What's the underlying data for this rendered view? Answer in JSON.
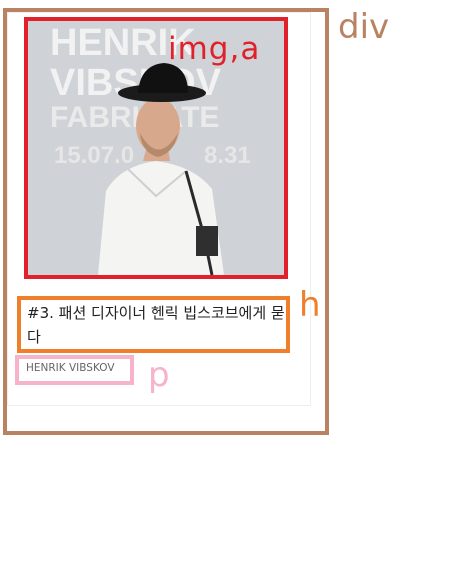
{
  "annotations": {
    "div_label": "div",
    "img_label": "img,a",
    "h_label": "h",
    "p_label": "p"
  },
  "card": {
    "image": {
      "alt": "Henrik Vibskov portrait",
      "poster_text": {
        "line1": "HENRIK",
        "line2": "VIBSKOV",
        "line3": "FABRIKATE",
        "date": "15.07.0",
        "date_end": "8.31"
      }
    },
    "title": "#3. 패션 디자이너 헨릭 빕스코브에게 묻다",
    "subtitle": "HENRIK VIBSKOV"
  },
  "colors": {
    "div_annotation": "#b98363",
    "img_annotation": "#e0202a",
    "h_annotation": "#f07f2c",
    "p_annotation": "#f6b3c9"
  }
}
